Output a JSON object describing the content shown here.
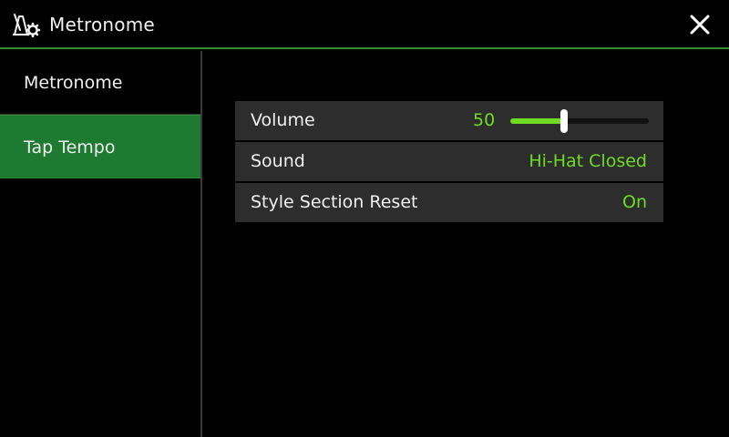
{
  "header": {
    "title": "Metronome",
    "icon": "metronome-settings-icon",
    "close_icon": "close-icon"
  },
  "sidebar": {
    "items": [
      {
        "label": "Metronome",
        "selected": false
      },
      {
        "label": "Tap Tempo",
        "selected": true
      }
    ]
  },
  "settings": {
    "volume": {
      "label": "Volume",
      "value": "50",
      "level": 0.39
    },
    "sound": {
      "label": "Sound",
      "value": "Hi-Hat Closed"
    },
    "style_section_reset": {
      "label": "Style Section Reset",
      "value": "On"
    }
  },
  "colors": {
    "accent": "#6edc23",
    "selected_bg": "#1e7a30",
    "row_bg": "#2d2d2d",
    "divider_green": "#2e8b36"
  }
}
